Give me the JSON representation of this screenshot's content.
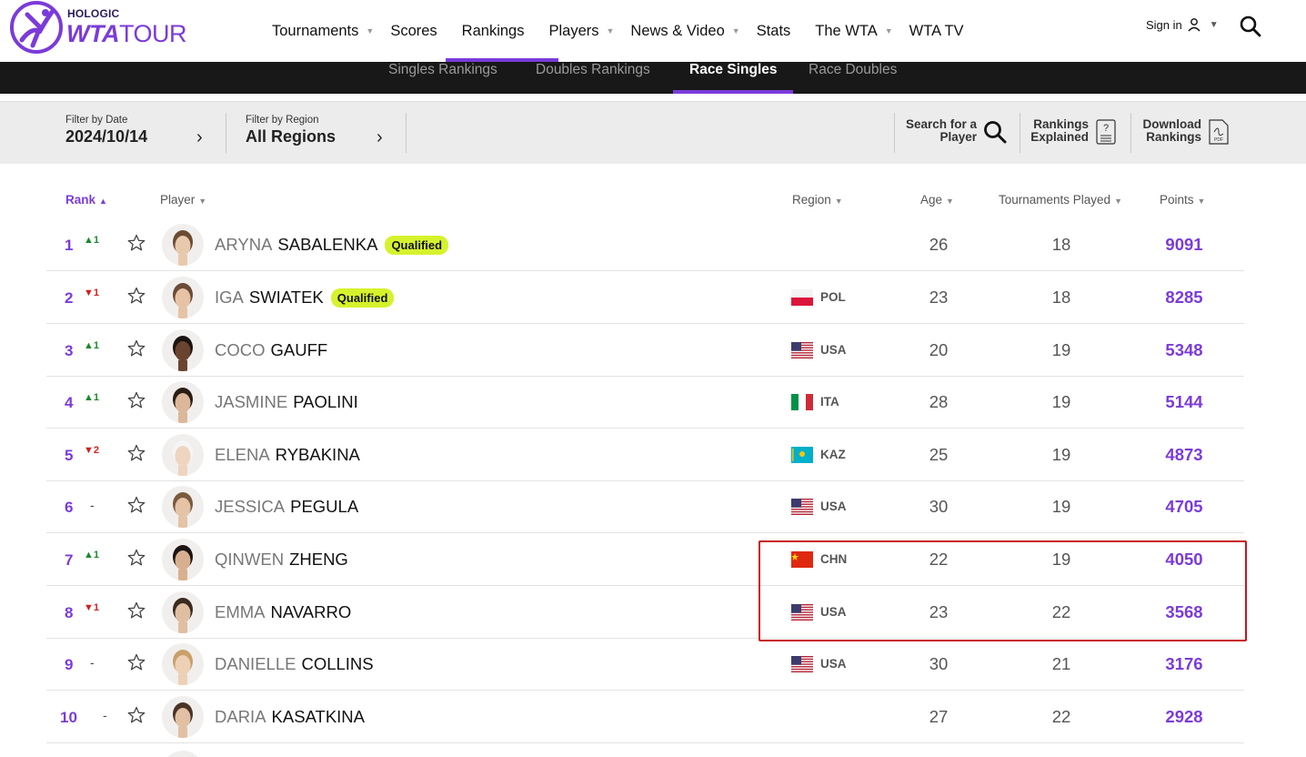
{
  "logo": {
    "brand_top": "HOLOGIC",
    "brand_main": "WTA",
    "brand_tour": "TOUR"
  },
  "nav": {
    "items": [
      {
        "label": "Tournaments",
        "caret": true
      },
      {
        "label": "Scores",
        "caret": false
      },
      {
        "label": "Rankings",
        "caret": false,
        "active": true
      },
      {
        "label": "Players",
        "caret": true
      },
      {
        "label": "News & Video",
        "caret": true
      },
      {
        "label": "Stats",
        "caret": false
      },
      {
        "label": "The WTA",
        "caret": true
      },
      {
        "label": "WTA TV",
        "caret": false
      }
    ],
    "sign_in": "Sign in"
  },
  "subnav": {
    "items": [
      "Singles Rankings",
      "Doubles Rankings",
      "Race Singles",
      "Race Doubles"
    ],
    "active": "Race Singles"
  },
  "filters": {
    "date_label": "Filter by Date",
    "date_value": "2024/10/14",
    "region_label": "Filter by Region",
    "region_value": "All Regions"
  },
  "tools": {
    "search_line1": "Search for a",
    "search_line2": "Player",
    "explained_line1": "Rankings",
    "explained_line2": "Explained",
    "download_line1": "Download",
    "download_line2": "Rankings",
    "pdf": "PDF"
  },
  "table": {
    "headers": {
      "rank": "Rank",
      "player": "Player",
      "region": "Region",
      "age": "Age",
      "tournaments": "Tournaments Played",
      "points": "Points"
    },
    "rows": [
      {
        "rank": "1",
        "move": "▲1",
        "dir": "up",
        "first": "ARYNA",
        "last": "SABALENKA",
        "badge": "Qualified",
        "flag": "",
        "code": "",
        "age": "26",
        "tp": "18",
        "points": "9091"
      },
      {
        "rank": "2",
        "move": "▼1",
        "dir": "down",
        "first": "IGA",
        "last": "SWIATEK",
        "badge": "Qualified",
        "flag": "pol",
        "code": "POL",
        "age": "23",
        "tp": "18",
        "points": "8285"
      },
      {
        "rank": "3",
        "move": "▲1",
        "dir": "up",
        "first": "COCO",
        "last": "GAUFF",
        "badge": "",
        "flag": "usa",
        "code": "USA",
        "age": "20",
        "tp": "19",
        "points": "5348"
      },
      {
        "rank": "4",
        "move": "▲1",
        "dir": "up",
        "first": "JASMINE",
        "last": "PAOLINI",
        "badge": "",
        "flag": "ita",
        "code": "ITA",
        "age": "28",
        "tp": "19",
        "points": "5144"
      },
      {
        "rank": "5",
        "move": "▼2",
        "dir": "down",
        "first": "ELENA",
        "last": "RYBAKINA",
        "badge": "",
        "flag": "kaz",
        "code": "KAZ",
        "age": "25",
        "tp": "19",
        "points": "4873"
      },
      {
        "rank": "6",
        "move": "-",
        "dir": "none",
        "first": "JESSICA",
        "last": "PEGULA",
        "badge": "",
        "flag": "usa",
        "code": "USA",
        "age": "30",
        "tp": "19",
        "points": "4705"
      },
      {
        "rank": "7",
        "move": "▲1",
        "dir": "up",
        "first": "QINWEN",
        "last": "ZHENG",
        "badge": "",
        "flag": "chn",
        "code": "CHN",
        "age": "22",
        "tp": "19",
        "points": "4050"
      },
      {
        "rank": "8",
        "move": "▼1",
        "dir": "down",
        "first": "EMMA",
        "last": "NAVARRO",
        "badge": "",
        "flag": "usa",
        "code": "USA",
        "age": "23",
        "tp": "22",
        "points": "3568"
      },
      {
        "rank": "9",
        "move": "-",
        "dir": "none",
        "first": "DANIELLE",
        "last": "COLLINS",
        "badge": "",
        "flag": "usa",
        "code": "USA",
        "age": "30",
        "tp": "21",
        "points": "3176"
      },
      {
        "rank": "10",
        "move": "-",
        "dir": "none",
        "first": "DARIA",
        "last": "KASATKINA",
        "badge": "",
        "flag": "",
        "code": "",
        "age": "27",
        "tp": "22",
        "points": "2928"
      }
    ]
  },
  "colors": {
    "accent": "#7b3bd9",
    "qualified": "#d6f22c",
    "up": "#1b8a2c",
    "down": "#d31f1f",
    "highlight": "#c8141a"
  }
}
